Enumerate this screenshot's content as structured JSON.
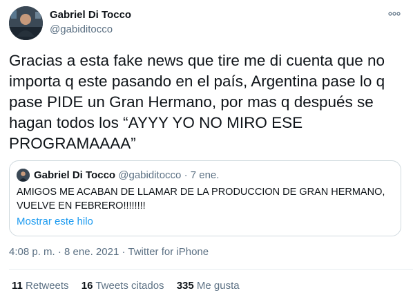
{
  "author": {
    "name": "Gabriel Di Tocco",
    "handle": "@gabiditocco"
  },
  "more_icon": "more-horizontal-icon",
  "tweet": {
    "text": "Gracias a esta fake news que tire me di cuenta que no importa q este pasando en el país, Argentina pase lo q pase PIDE un Gran Hermano, por mas q después se hagan todos los “AYYY YO NO MIRO ESE PROGRAMAAAA”",
    "time": "4:08 p. m.",
    "date": "8 ene. 2021",
    "separator": "·",
    "source": "Twitter for iPhone"
  },
  "quoted": {
    "name": "Gabriel Di Tocco",
    "handle": "@gabiditocco",
    "separator": "·",
    "date": "7 ene.",
    "text": "AMIGOS ME ACABAN DE LLAMAR DE LA PRODUCCION DE GRAN HERMANO, VUELVE EN FEBRERO!!!!!!!!",
    "show_thread": "Mostrar este hilo"
  },
  "stats": {
    "retweets": {
      "count": "11",
      "label": "Retweets"
    },
    "quotes": {
      "count": "16",
      "label": "Tweets citados"
    },
    "likes": {
      "count": "335",
      "label": "Me gusta"
    }
  },
  "colors": {
    "text": "#0f1419",
    "secondary": "#5b7083",
    "link": "#1d9bf0",
    "border": "#cfd9de"
  }
}
